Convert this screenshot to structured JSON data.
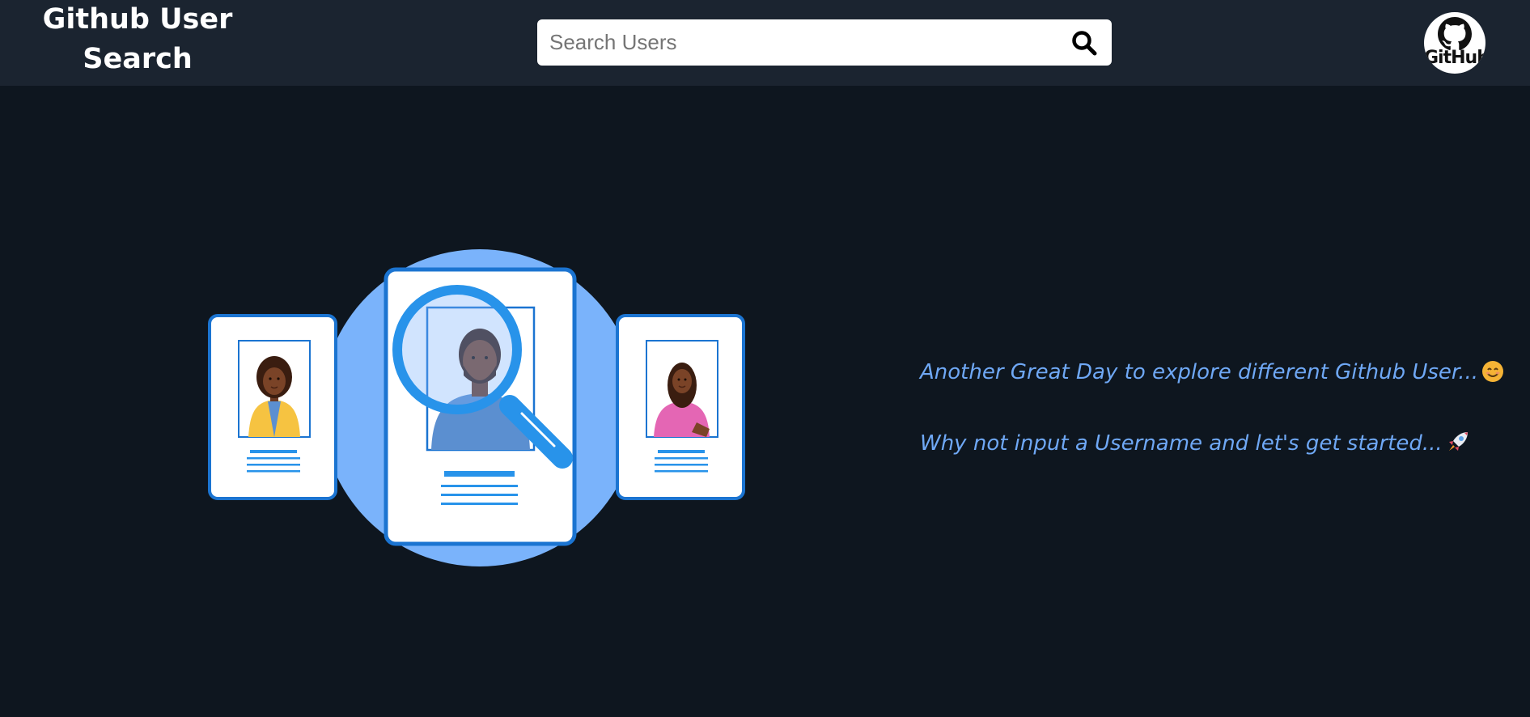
{
  "header": {
    "brand_line1": "Github User",
    "brand_line2": "Search",
    "search": {
      "placeholder": "Search Users",
      "value": ""
    },
    "icons": {
      "search": "search-icon",
      "profile": "github-logo-icon"
    },
    "github_badge_text": "GitHub"
  },
  "main": {
    "illustration": "user-search-illustration",
    "message_1": "Another Great Day to explore different Github User...",
    "message_1_emoji": "smiling-face-emoji",
    "message_2": "Why not input a Username and let's get started...",
    "message_2_emoji": "rocket-emoji"
  },
  "colors": {
    "header_bg": "#1b2430",
    "page_bg": "#0e161f",
    "message_text": "#6fa8f5",
    "illustration_circle": "#7ab3fb",
    "card_border": "#1b74d1",
    "accent_blue": "#2893ea"
  }
}
